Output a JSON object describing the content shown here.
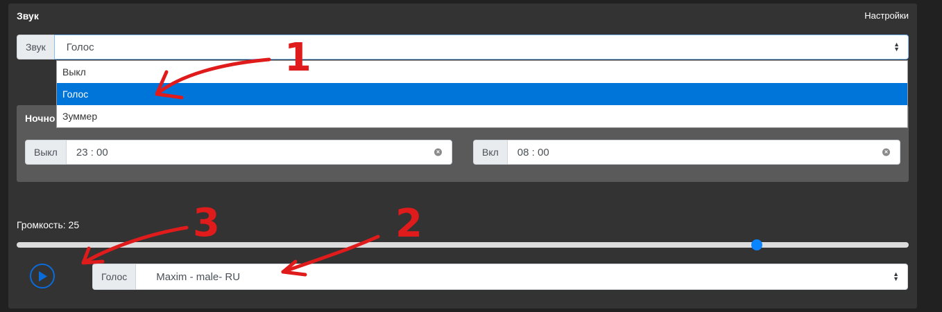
{
  "card": {
    "title": "Звук",
    "settings_label": "Настройки"
  },
  "sound_select": {
    "label": "Звук",
    "value": "Голос",
    "options": [
      "Выкл",
      "Голос",
      "Зуммер"
    ]
  },
  "night_mode": {
    "title_visible": "Ночно",
    "off_label": "Выкл",
    "off_time": "23 : 00",
    "on_label": "Вкл",
    "on_time": "08 : 00"
  },
  "volume": {
    "label": "Громкость: 25",
    "level_fraction": 0.83
  },
  "voice_select": {
    "label": "Голос",
    "value": "Maxim - male- RU"
  },
  "annotations": [
    "1",
    "2",
    "3"
  ],
  "colors": {
    "accent": "#0a84ff",
    "selected_option": "#0075d9",
    "annotation": "#e01b1b"
  }
}
